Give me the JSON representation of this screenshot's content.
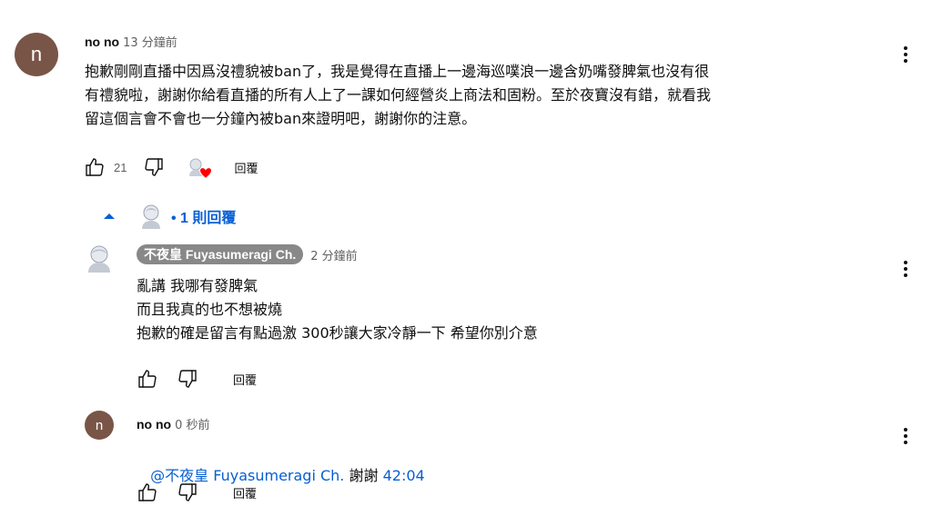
{
  "comment": {
    "avatar_letter": "n",
    "author": "no no",
    "time": "13 分鐘前",
    "lines": [
      "抱歉剛剛直播中因爲沒禮貌被ban了，我是覺得在直播上一邊海巡噗浪一邊含奶嘴發脾氣也沒有很",
      "有禮貌啦，謝謝你給看直播的所有人上了一課如何經營炎上商法和固粉。至於夜寶沒有錯，就看我",
      "留這個言會不會也一分鐘內被ban來證明吧，謝謝你的注意。"
    ],
    "likes": "21",
    "reply_label": "回覆"
  },
  "replies_toggle": {
    "label": "• 1 則回覆"
  },
  "reply1": {
    "author": "不夜皇 Fuyasumeragi Ch.",
    "time": "2 分鐘前",
    "lines": [
      "亂講 我哪有發脾氣",
      "而且我真的也不想被燒",
      "抱歉的確是留言有點過激 300秒讓大家冷靜一下 希望你別介意"
    ],
    "reply_label": "回覆"
  },
  "reply2": {
    "avatar_letter": "n",
    "author": "no no",
    "time": "0 秒前",
    "mention": "@不夜皇 Fuyasumeragi Ch.",
    "text_mid": " 謝謝 ",
    "timestamp": "42:04",
    "reply_label": "回覆"
  },
  "colors": {
    "avatar_bg": "#795548",
    "link": "#065fd4",
    "chip_bg": "#888888",
    "heart": "#ff0000"
  }
}
